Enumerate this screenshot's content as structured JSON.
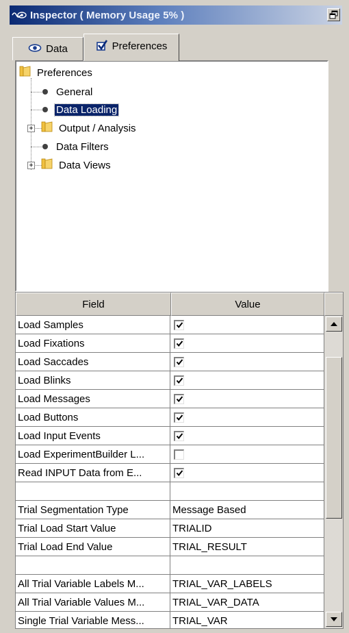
{
  "window": {
    "title": "Inspector ( Memory Usage 5% )",
    "app_icon": "eye-wave-icon",
    "restore_icon": "restore-window-icon"
  },
  "tabs": [
    {
      "label": "Data",
      "icon": "eye-icon",
      "active": false
    },
    {
      "label": "Preferences",
      "icon": "checkbox-check-icon",
      "active": true
    }
  ],
  "tree": {
    "root": "Preferences",
    "items": [
      {
        "label": "General",
        "type": "leaf",
        "selected": false
      },
      {
        "label": "Data Loading",
        "type": "leaf",
        "selected": true
      },
      {
        "label": "Output / Analysis",
        "type": "folder",
        "expandable": true
      },
      {
        "label": "Data Filters",
        "type": "leaf",
        "selected": false
      },
      {
        "label": "Data Views",
        "type": "folder",
        "expandable": true
      }
    ]
  },
  "grid": {
    "columns": [
      "Field",
      "Value"
    ],
    "rows": [
      {
        "field": "Load Samples",
        "type": "checkbox",
        "checked": true
      },
      {
        "field": "Load Fixations",
        "type": "checkbox",
        "checked": true
      },
      {
        "field": "Load Saccades",
        "type": "checkbox",
        "checked": true
      },
      {
        "field": "Load Blinks",
        "type": "checkbox",
        "checked": true
      },
      {
        "field": "Load Messages",
        "type": "checkbox",
        "checked": true
      },
      {
        "field": "Load Buttons",
        "type": "checkbox",
        "checked": true
      },
      {
        "field": "Load Input Events",
        "type": "checkbox",
        "checked": true
      },
      {
        "field": "Load ExperimentBuilder L...",
        "type": "checkbox",
        "checked": false
      },
      {
        "field": "Read INPUT Data from E...",
        "type": "checkbox",
        "checked": true
      },
      {
        "field": "",
        "type": "empty",
        "value": ""
      },
      {
        "field": "Trial Segmentation Type",
        "type": "text",
        "value": "Message Based"
      },
      {
        "field": "Trial Load Start Value",
        "type": "text",
        "value": "TRIALID"
      },
      {
        "field": "Trial Load End Value",
        "type": "text",
        "value": "TRIAL_RESULT"
      },
      {
        "field": "",
        "type": "empty",
        "value": ""
      },
      {
        "field": "All Trial Variable Labels M...",
        "type": "text",
        "value": "TRIAL_VAR_LABELS"
      },
      {
        "field": "All Trial Variable Values M...",
        "type": "text",
        "value": "TRIAL_VAR_DATA"
      },
      {
        "field": "Single Trial Variable Mess...",
        "type": "text",
        "value": "TRIAL_VAR"
      }
    ]
  },
  "scrollbar": {
    "up_icon": "arrow-up-icon",
    "down_icon": "arrow-down-icon"
  }
}
